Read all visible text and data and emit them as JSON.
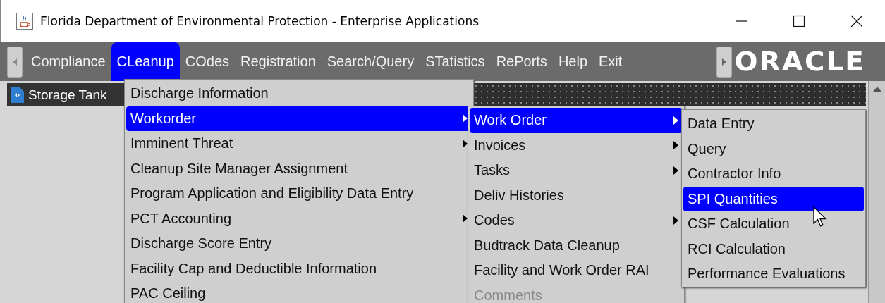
{
  "window": {
    "title": "Florida Department of Environmental Protection - Enterprise Applications"
  },
  "menu_bar": {
    "items": [
      {
        "label": "Compliance",
        "selected": false
      },
      {
        "label": "CLeanup",
        "selected": true
      },
      {
        "label": "COdes",
        "selected": false
      },
      {
        "label": "Registration",
        "selected": false
      },
      {
        "label": "Search/Query",
        "selected": false
      },
      {
        "label": "STatistics",
        "selected": false
      },
      {
        "label": "RePorts",
        "selected": false
      },
      {
        "label": "Help",
        "selected": false
      },
      {
        "label": "Exit",
        "selected": false
      }
    ],
    "logo": "ORACLE"
  },
  "document_tab": {
    "label": "Storage Tank"
  },
  "menus": [
    {
      "items": [
        {
          "label": "Discharge Information",
          "selected": false,
          "submenu": false,
          "disabled": false
        },
        {
          "label": "Workorder",
          "selected": true,
          "submenu": true,
          "disabled": false
        },
        {
          "label": "Imminent Threat",
          "selected": false,
          "submenu": true,
          "disabled": false
        },
        {
          "label": "Cleanup Site Manager Assignment",
          "selected": false,
          "submenu": false,
          "disabled": false
        },
        {
          "label": "Program Application and Eligibility Data Entry",
          "selected": false,
          "submenu": false,
          "disabled": false
        },
        {
          "label": "PCT Accounting",
          "selected": false,
          "submenu": true,
          "disabled": false
        },
        {
          "label": "Discharge Score Entry",
          "selected": false,
          "submenu": false,
          "disabled": false
        },
        {
          "label": "Facility Cap and Deductible Information",
          "selected": false,
          "submenu": false,
          "disabled": false
        },
        {
          "label": "PAC Ceiling",
          "selected": false,
          "submenu": false,
          "disabled": false
        }
      ]
    },
    {
      "items": [
        {
          "label": "Work Order",
          "selected": true,
          "submenu": true,
          "disabled": false
        },
        {
          "label": "Invoices",
          "selected": false,
          "submenu": true,
          "disabled": false
        },
        {
          "label": "Tasks",
          "selected": false,
          "submenu": true,
          "disabled": false
        },
        {
          "label": "Deliv Histories",
          "selected": false,
          "submenu": false,
          "disabled": false
        },
        {
          "label": "Codes",
          "selected": false,
          "submenu": true,
          "disabled": false
        },
        {
          "label": "Budtrack Data Cleanup",
          "selected": false,
          "submenu": false,
          "disabled": false
        },
        {
          "label": "Facility and Work Order RAI",
          "selected": false,
          "submenu": false,
          "disabled": false
        },
        {
          "label": "Comments",
          "selected": false,
          "submenu": false,
          "disabled": true
        }
      ]
    },
    {
      "items": [
        {
          "label": "Data Entry",
          "selected": false,
          "submenu": false,
          "disabled": false
        },
        {
          "label": "Query",
          "selected": false,
          "submenu": false,
          "disabled": false
        },
        {
          "label": "Contractor Info",
          "selected": false,
          "submenu": false,
          "disabled": false
        },
        {
          "label": "SPI Quantities",
          "selected": true,
          "submenu": false,
          "disabled": false
        },
        {
          "label": "CSF Calculation",
          "selected": false,
          "submenu": false,
          "disabled": false
        },
        {
          "label": "RCI Calculation",
          "selected": false,
          "submenu": false,
          "disabled": false
        },
        {
          "label": "Performance Evaluations",
          "selected": false,
          "submenu": false,
          "disabled": false
        }
      ]
    }
  ]
}
